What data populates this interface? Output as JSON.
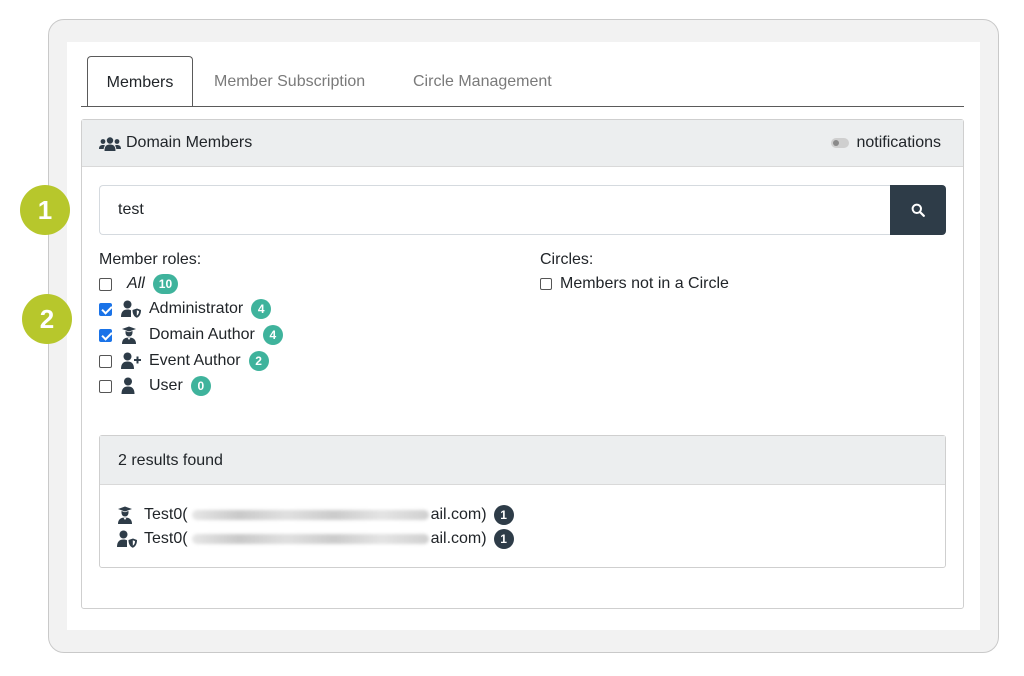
{
  "tabs": [
    "Members",
    "Member Subscription",
    "Circle Management"
  ],
  "card": {
    "title": "Domain Members",
    "notifications_label": "notifications"
  },
  "search": {
    "value": "test"
  },
  "callouts": [
    "1",
    "2"
  ],
  "roles": {
    "label": "Member roles:",
    "items": [
      {
        "label": "All",
        "count": "10",
        "checked": false,
        "icon": "none"
      },
      {
        "label": "Administrator",
        "count": "4",
        "checked": true,
        "icon": "user-shield-icon"
      },
      {
        "label": "Domain Author",
        "count": "4",
        "checked": true,
        "icon": "user-graduate-icon"
      },
      {
        "label": "Event Author",
        "count": "2",
        "checked": false,
        "icon": "user-plus-icon"
      },
      {
        "label": "User",
        "count": "0",
        "checked": false,
        "icon": "user-icon"
      }
    ]
  },
  "circles": {
    "label": "Circles:",
    "option": "Members not in a Circle"
  },
  "results": {
    "header": "2 results found",
    "rows": [
      {
        "prefix": "Test0(",
        "suffix": "ail.com)",
        "badge": "1",
        "icon": "user-graduate-icon"
      },
      {
        "prefix": "Test0(",
        "suffix": "ail.com)",
        "badge": "1",
        "icon": "user-shield-icon"
      }
    ]
  },
  "colors": {
    "accent_green": "#b7c72c",
    "badge_teal": "#3fb39c",
    "dark_navy": "#2e3c48"
  }
}
